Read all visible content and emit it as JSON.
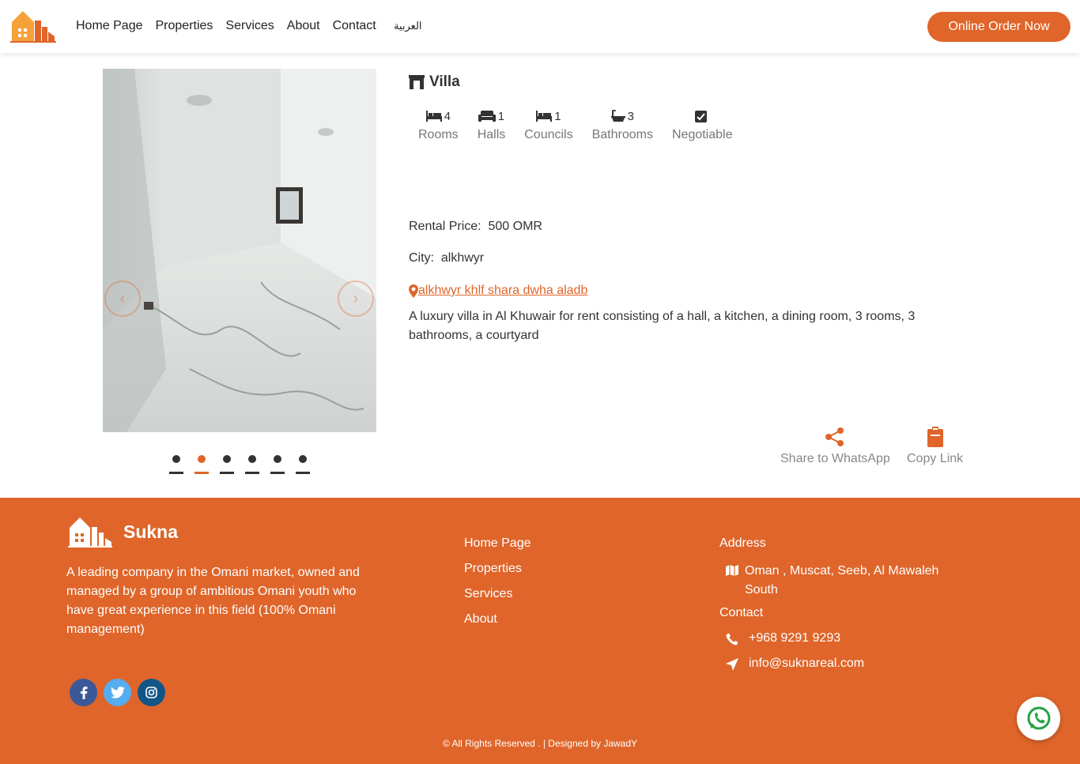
{
  "nav": {
    "links": [
      "Home Page",
      "Properties",
      "Services",
      "About",
      "Contact"
    ],
    "language": "العربية",
    "order_button": "Online Order Now"
  },
  "gallery": {
    "slide_count": 6,
    "active_slide": 2
  },
  "property": {
    "type": "Villa",
    "features": [
      {
        "icon": "bed-icon",
        "value": "4",
        "label": "Rooms"
      },
      {
        "icon": "couch-icon",
        "value": "1",
        "label": "Halls"
      },
      {
        "icon": "bed-icon",
        "value": "1",
        "label": "Councils"
      },
      {
        "icon": "bath-icon",
        "value": "3",
        "label": "Bathrooms"
      },
      {
        "icon": "check-square-icon",
        "value": "",
        "label": "Negotiable"
      }
    ],
    "price_label": "Rental Price:",
    "price_value": "500 OMR",
    "city_label": "City:",
    "city_value": "alkhwyr",
    "location": "alkhwyr khlf shara dwha aladb",
    "description": "A luxury villa in Al Khuwair for rent consisting of a hall, a kitchen, a dining room, 3 rooms, 3 bathrooms, a courtyard",
    "share_label": "Share to WhatsApp",
    "copy_label": "Copy Link"
  },
  "footer": {
    "brand": "Sukna",
    "about": "A leading company in the Omani market, owned and managed by a group of ambitious Omani youth who have great experience in this field (100% Omani management)",
    "links": [
      "Home Page",
      "Properties",
      "Services",
      "About"
    ],
    "address_heading": "Address",
    "address": "Oman , Muscat, Seeb, Al Mawaleh South",
    "contact_heading": "Contact",
    "phone": "+968 9291 9293",
    "email": "info@suknareal.com",
    "copyright": "© All Rights Reserved . | Designed by JawadY"
  },
  "colors": {
    "accent": "#df652a",
    "facebook": "#3b5998",
    "twitter": "#55acee",
    "instagram": "#125688",
    "whatsapp": "#25a244"
  }
}
